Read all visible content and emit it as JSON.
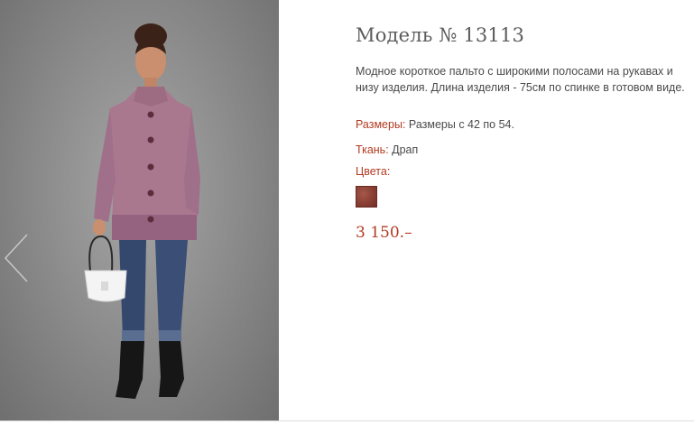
{
  "product": {
    "title": "Модель № 13113",
    "description": "Модное короткое пальто с широкими полосами на рукавах и низу изделия. Длина изделия - 75см по спинке в готовом виде.",
    "sizes_label": "Размеры:",
    "sizes_value": " Размеры с 42 по 54.",
    "fabric_label": "Ткань:",
    "fabric_value": " Драп",
    "colors_label": "Цвета:",
    "price": "3 150.–",
    "accent_color": "#b23a21",
    "swatch_color": "#8a3f34"
  },
  "icons": {
    "prev": "chevron-left-icon"
  }
}
